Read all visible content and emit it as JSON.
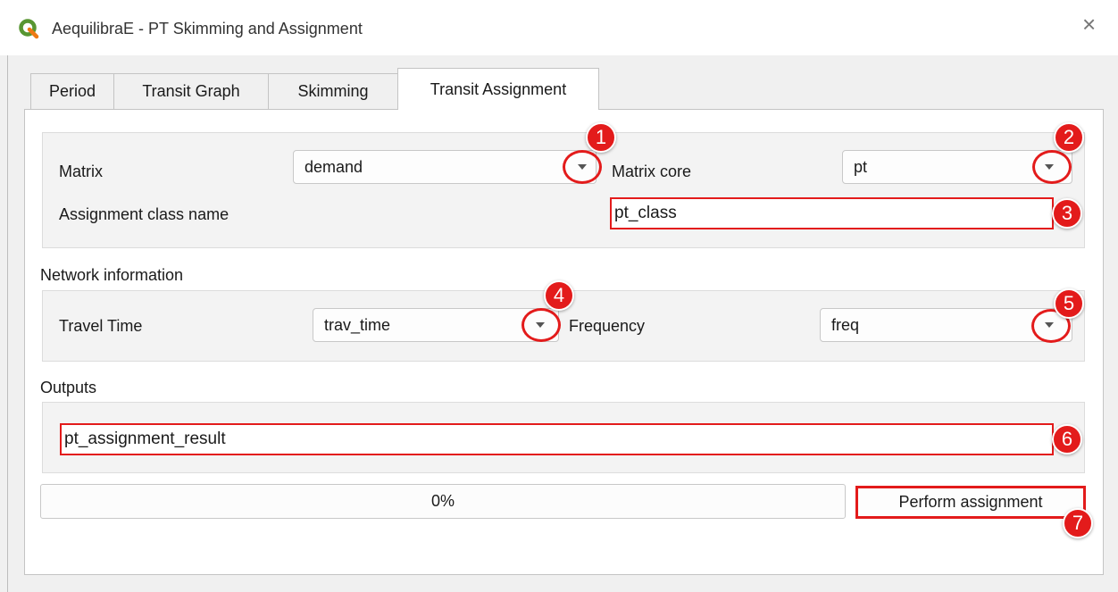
{
  "window": {
    "title": "AequilibraE - PT Skimming and Assignment",
    "close_icon": "×"
  },
  "tabs": [
    {
      "label": "Period"
    },
    {
      "label": "Transit Graph"
    },
    {
      "label": "Skimming"
    },
    {
      "label": "Transit Assignment",
      "active": true
    }
  ],
  "assignment": {
    "matrix_label": "Matrix",
    "matrix_value": "demand",
    "matrix_core_label": "Matrix core",
    "matrix_core_value": "pt",
    "class_name_label": "Assignment class name",
    "class_name_value": "pt_class"
  },
  "network": {
    "section_label": "Network information",
    "travel_time_label": "Travel Time",
    "travel_time_value": "trav_time",
    "frequency_label": "Frequency",
    "frequency_value": "freq"
  },
  "outputs": {
    "section_label": "Outputs",
    "result_name": "pt_assignment_result"
  },
  "progress": {
    "text": "0%",
    "fraction": 0
  },
  "actions": {
    "perform_label": "Perform assignment"
  },
  "annotations": [
    "1",
    "2",
    "3",
    "4",
    "5",
    "6",
    "7"
  ],
  "colors": {
    "annotation_red": "#e31b1b",
    "qgis_green": "#589632"
  }
}
